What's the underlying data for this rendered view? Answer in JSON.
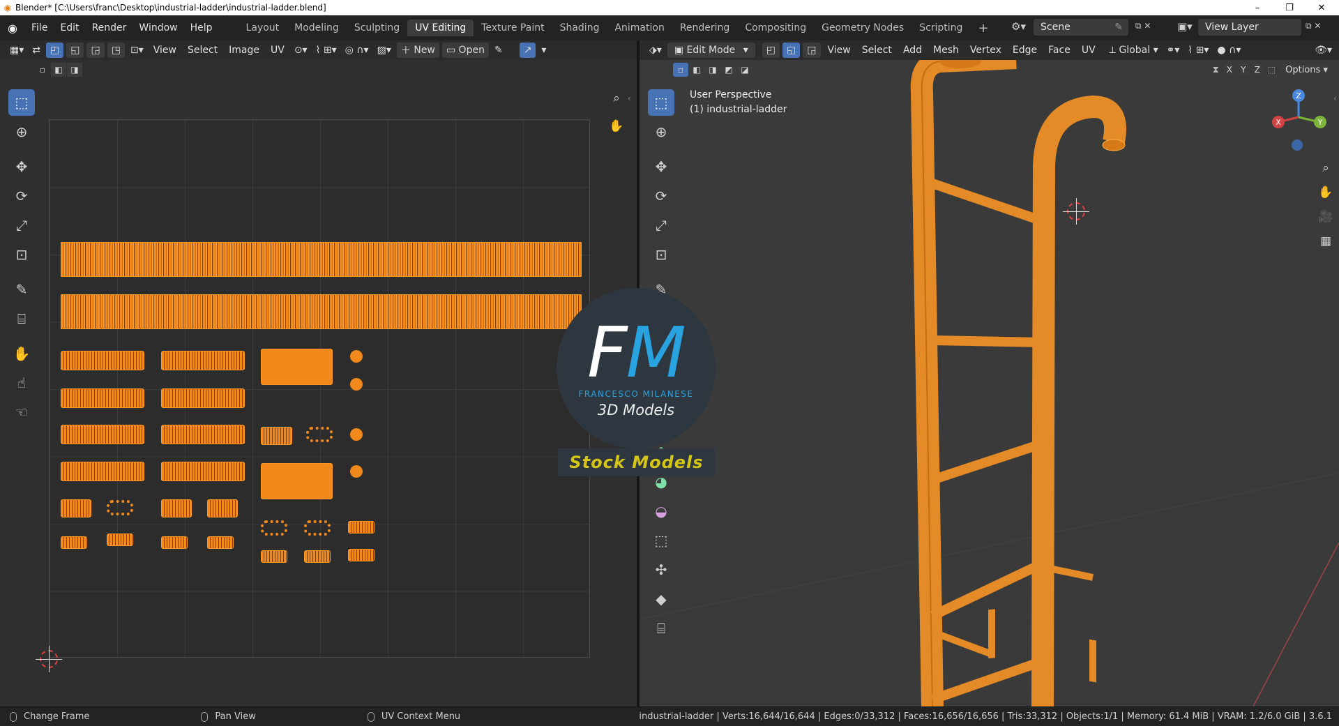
{
  "window": {
    "title": "Blender* [C:\\Users\\franc\\Desktop\\industrial-ladder\\industrial-ladder.blend]",
    "controls": [
      "–",
      "❐",
      "✕"
    ]
  },
  "topbar": {
    "menus": [
      "File",
      "Edit",
      "Render",
      "Window",
      "Help"
    ],
    "workspaces": [
      "Layout",
      "Modeling",
      "Sculpting",
      "UV Editing",
      "Texture Paint",
      "Shading",
      "Animation",
      "Rendering",
      "Compositing",
      "Geometry Nodes",
      "Scripting"
    ],
    "active_workspace": "UV Editing",
    "add_tab": "+",
    "scene": "Scene",
    "view_layer": "View Layer"
  },
  "uv_editor": {
    "menus": [
      "View",
      "Select",
      "Image",
      "UV"
    ],
    "new_label": "New",
    "open_label": "Open"
  },
  "viewport": {
    "mode": "Edit Mode",
    "menus": [
      "View",
      "Select",
      "Add",
      "Mesh",
      "Vertex",
      "Edge",
      "Face",
      "UV"
    ],
    "orientation": "Global",
    "axes": [
      "X",
      "Y",
      "Z"
    ],
    "options_label": "Options",
    "perspective": "User Perspective",
    "object_label": "(1) industrial-ladder",
    "gizmo": {
      "x": "X",
      "y": "Y",
      "z": "Z"
    }
  },
  "logo": {
    "letter_f": "F",
    "letter_m": "M",
    "name": "FRANCESCO MILANESE",
    "subtitle": "3D Models",
    "band": "Stock Models"
  },
  "statusbar": {
    "hint1": "Change Frame",
    "hint2": "Pan View",
    "hint3": "UV Context Menu",
    "stats": "industrial-ladder | Verts:16,644/16,644 | Edges:0/33,312 | Faces:16,656/16,656 | Tris:33,312 | Objects:1/1 | Memory: 61.4 MiB | VRAM: 1.2/6.0 GiB | 3.6.1"
  },
  "colors": {
    "accent": "#4772b3",
    "selection": "#f28a1b",
    "logo_blue": "#29a3e0",
    "logo_yellow": "#d4c516"
  }
}
